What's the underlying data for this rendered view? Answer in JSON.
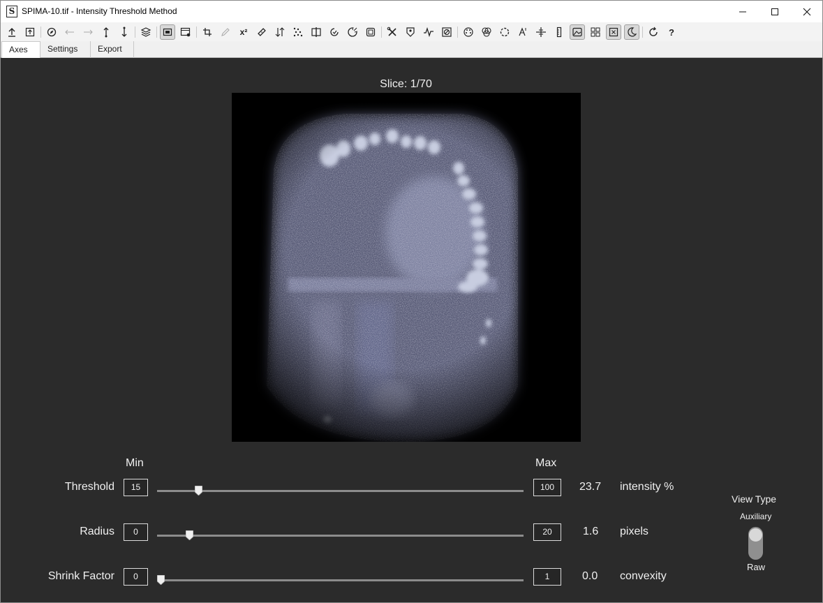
{
  "window": {
    "title": "SPIMA-10.tif - Intensity Threshold Method",
    "app_icon_letter": "S"
  },
  "toolbar": {
    "icons": [
      "open-file-icon",
      "export-icon",
      "compass-icon",
      "arrow-left-icon",
      "arrow-right-icon",
      "arrow-up-down-icon",
      "arrow-down-up-icon",
      "layers-icon",
      "view-toggle-icon",
      "window-settings-icon",
      "crop-icon",
      "pencil-icon",
      "superscript-icon",
      "bandage-icon",
      "sort-icon",
      "scatter-icon",
      "split-icon",
      "rotate-check-icon",
      "burst-icon",
      "frame-icon",
      "tools-icon",
      "tag-icon",
      "waveform-icon",
      "clear-icon",
      "palette-icon",
      "circles-icon",
      "dashed-circle-icon",
      "text-cursor-icon",
      "crosshair-icon",
      "ruler-icon",
      "image-icon",
      "grid-icon",
      "checkbox-icon",
      "moon-icon",
      "refresh-icon",
      "help-icon"
    ],
    "superscript_label": "x²",
    "help_label": "?"
  },
  "tabs": [
    {
      "label": "Axes",
      "active": true
    },
    {
      "label": "Settings",
      "active": false
    },
    {
      "label": "Export",
      "active": false
    }
  ],
  "viewer": {
    "slice_label": "Slice: 1/70"
  },
  "controls": {
    "min_header": "Min",
    "max_header": "Max",
    "rows": [
      {
        "label": "Threshold",
        "min": "15",
        "max": "100",
        "value": "23.7",
        "unit": "intensity %",
        "fraction": 0.103
      },
      {
        "label": "Radius",
        "min": "0",
        "max": "20",
        "value": "1.6",
        "unit": "pixels",
        "fraction": 0.078
      },
      {
        "label": "Shrink Factor",
        "min": "0",
        "max": "1",
        "value": "0.0",
        "unit": "convexity",
        "fraction": 0.0
      }
    ]
  },
  "view_type": {
    "title": "View Type",
    "top_option": "Auxiliary",
    "bottom_option": "Raw"
  },
  "colors": {
    "background": "#2b2b2b",
    "text": "#f0f0f0",
    "image_tint": "#8c8fb0"
  }
}
